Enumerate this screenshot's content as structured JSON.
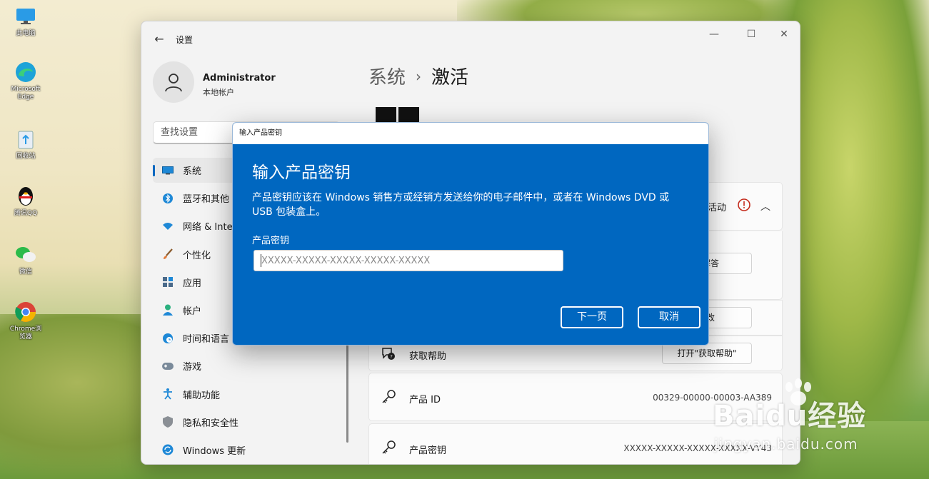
{
  "desktop": {
    "icons": [
      {
        "label": "此电脑",
        "icon": "monitor-icon"
      },
      {
        "label": "Microsoft Edge",
        "icon": "edge-icon"
      },
      {
        "label": "回收站",
        "icon": "recycle-bin-icon"
      },
      {
        "label": "腾讯QQ",
        "icon": "qq-penguin-icon"
      },
      {
        "label": "微信",
        "icon": "wechat-icon"
      },
      {
        "label": "Chrome浏览器",
        "icon": "chrome-icon"
      }
    ]
  },
  "settings": {
    "window_title": "设置",
    "user": {
      "name": "Administrator",
      "type": "本地帐户"
    },
    "search_placeholder": "查找设置",
    "nav": [
      {
        "label": "系统",
        "icon": "monitor-icon",
        "active": true
      },
      {
        "label": "蓝牙和其他",
        "icon": "bluetooth-icon"
      },
      {
        "label": "网络 & Inte",
        "icon": "wifi-icon"
      },
      {
        "label": "个性化",
        "icon": "brush-icon"
      },
      {
        "label": "应用",
        "icon": "apps-icon"
      },
      {
        "label": "帐户",
        "icon": "person-icon"
      },
      {
        "label": "时间和语言",
        "icon": "clock-globe-icon"
      },
      {
        "label": "游戏",
        "icon": "gamepad-icon"
      },
      {
        "label": "辅助功能",
        "icon": "accessibility-icon"
      },
      {
        "label": "隐私和安全性",
        "icon": "shield-icon"
      },
      {
        "label": "Windows 更新",
        "icon": "update-icon"
      }
    ],
    "breadcrumb": {
      "parent": "系统",
      "separator": "›",
      "current": "激活"
    },
    "activation_state_partial": "活动",
    "troubleshoot_btn_partial": "解答",
    "change_btn_partial": "改",
    "help_row": {
      "title": "获取帮助",
      "button": "打开\"获取帮助\""
    },
    "product_id_row": {
      "title": "产品 ID",
      "value": "00329-00000-00003-AA389"
    },
    "product_key_row": {
      "title": "产品密钥",
      "value": "XXXXX-XXXXX-XXXXX-XXXXX-VY43"
    }
  },
  "dialog": {
    "window_title": "输入产品密钥",
    "heading": "输入产品密钥",
    "description": "产品密钥应该在 Windows 销售方或经销方发送给你的电子邮件中，或者在 Windows DVD 或 USB 包装盒上。",
    "field_label": "产品密钥",
    "field_placeholder": "XXXXX-XXXXX-XXXXX-XXXXX-XXXXX",
    "field_value": "",
    "next_button": "下一页",
    "cancel_button": "取消"
  },
  "watermark": {
    "main": "Baidu经验",
    "sub": "jingyan.baidu.com"
  },
  "colors": {
    "accent": "#0067c0",
    "dialog_bg": "#0067c0",
    "window_bg": "#f3f3f3",
    "warning": "#c42b1c"
  }
}
